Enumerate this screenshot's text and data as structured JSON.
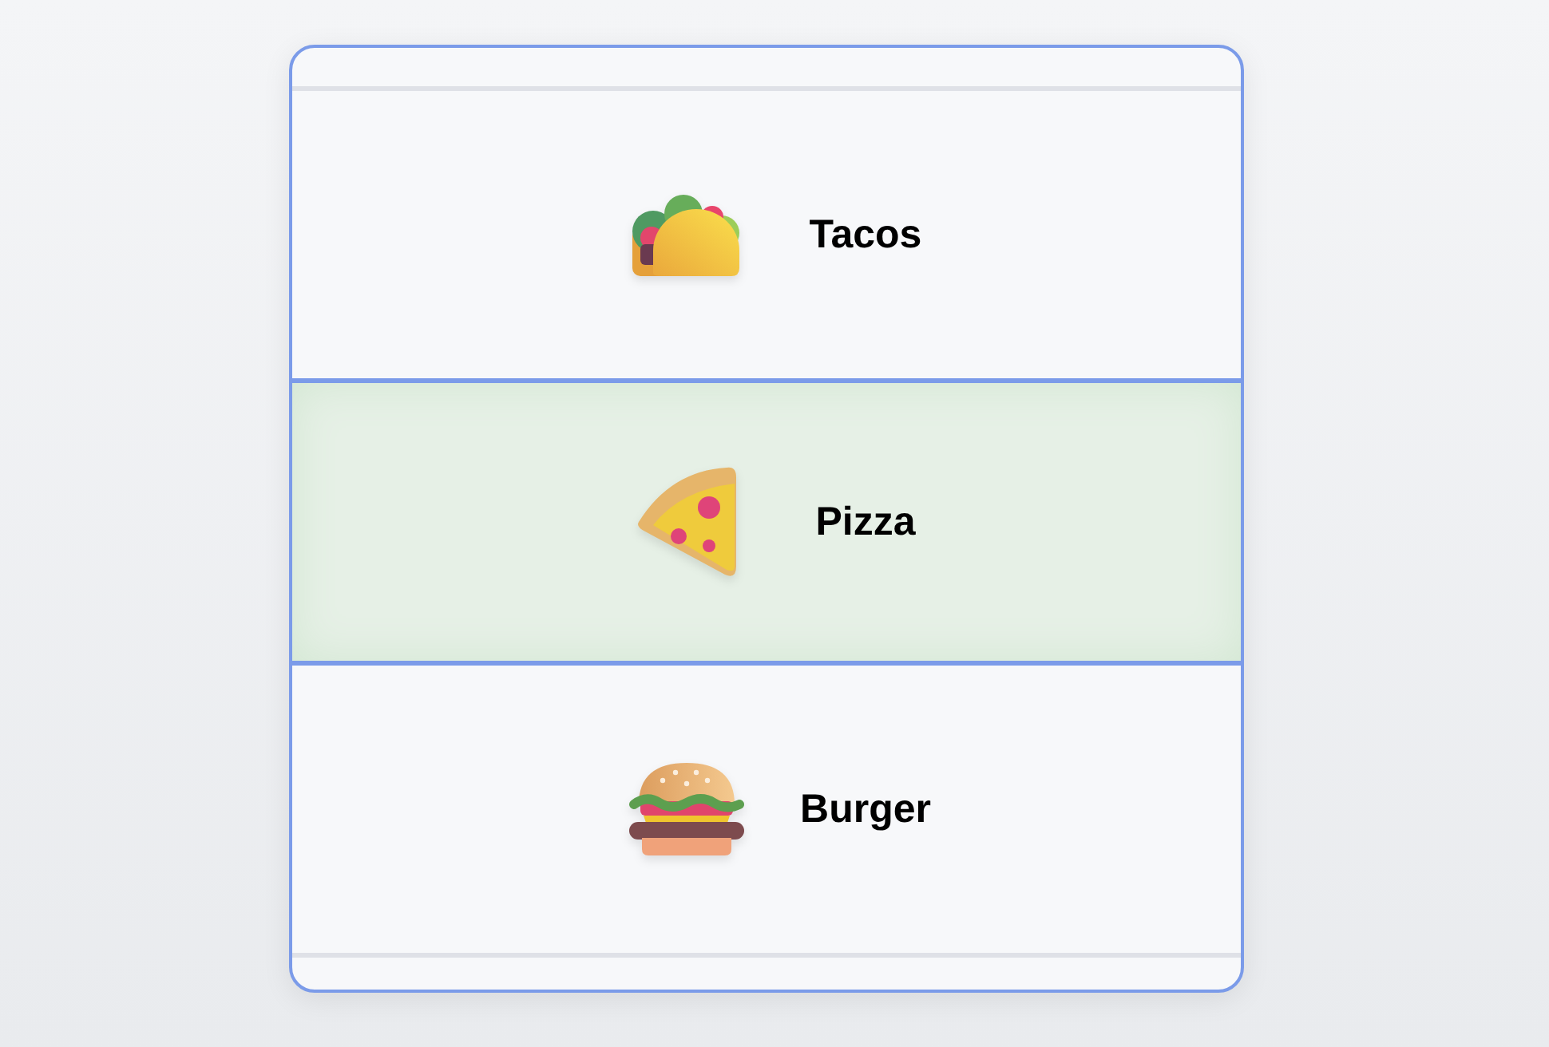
{
  "items": [
    {
      "label": "Tacos",
      "kind": "taco",
      "selected": false
    },
    {
      "label": "Pizza",
      "kind": "pizza",
      "selected": true
    },
    {
      "label": "Burger",
      "kind": "burger",
      "selected": false
    }
  ]
}
